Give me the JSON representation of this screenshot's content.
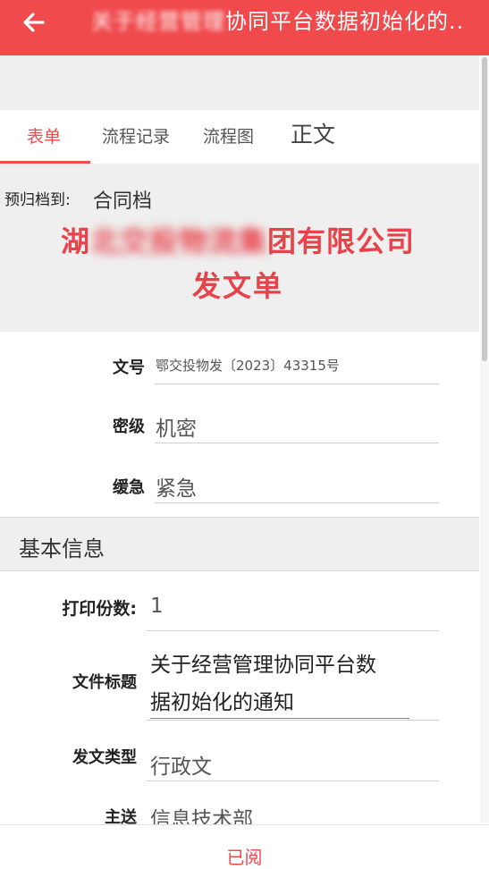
{
  "header": {
    "title_blurred": "关于经营管理",
    "title": "协同平台数据初始化的..",
    "back_icon": "arrow-left-icon"
  },
  "tabs": [
    {
      "label": "表单",
      "active": true
    },
    {
      "label": "流程记录"
    },
    {
      "label": "流程图"
    },
    {
      "label": "正文"
    }
  ],
  "form_header": {
    "archive_label": "预归档到:",
    "archive_value": "合同档",
    "company_start": "湖",
    "company_blurred": "北交投物流集",
    "company_end": "团有限公司",
    "doc_type": "发文单"
  },
  "fields": {
    "doc_no": {
      "label": "文号",
      "value": "鄂交投物发〔2023〕43315号"
    },
    "secret": {
      "label": "密级",
      "value": "机密"
    },
    "urgency": {
      "label": "缓急",
      "value": "紧急"
    }
  },
  "section": {
    "title": "基本信息"
  },
  "basic": {
    "copies": {
      "label": "打印份数:",
      "value": "1"
    },
    "title": {
      "label": "文件标题",
      "value_line1": "关于经营管理协同平台数",
      "value_line2": "据初始化的通知"
    },
    "type": {
      "label": "发文类型",
      "value": "行政文"
    },
    "recipient": {
      "label": "主送",
      "value": "信息技术部"
    }
  },
  "footer": {
    "read_label": "已阅"
  },
  "colors": {
    "accent": "#f04a4c",
    "panel": "#efefef"
  }
}
